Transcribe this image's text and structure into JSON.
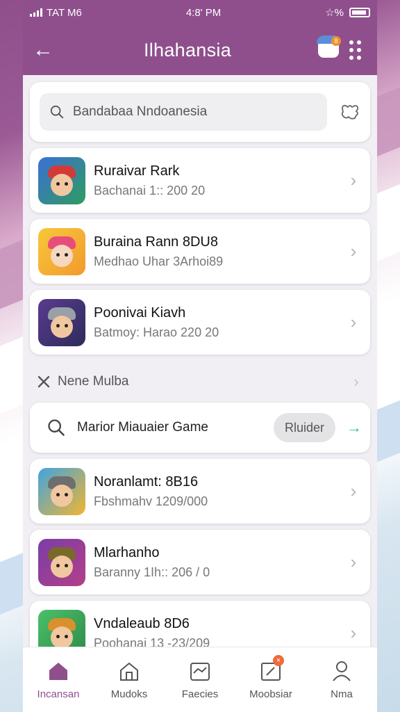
{
  "status": {
    "carrier": "TAT M6",
    "time": "4:8' PM",
    "extra": "☆%"
  },
  "header": {
    "title": "Ilhahansia"
  },
  "notification": {
    "badge": "8"
  },
  "search": {
    "placeholder": "Bandabaa Nndoanesia"
  },
  "games_top": [
    {
      "name": "Ruraivar Rark",
      "sub": "Bachanai 1:: 200 20"
    },
    {
      "name": "Buraina Rann 8DU8",
      "sub": "Medhao Uhar 3Arhoi89"
    },
    {
      "name": "Poonivai Kiavh",
      "sub": "Batmoy: Harao 220 20"
    }
  ],
  "section": {
    "label": "Nene Mulba"
  },
  "finder": {
    "text": "Marior Miauaier Game",
    "button": "Rluider"
  },
  "games_bottom": [
    {
      "name": "Noranlamt: 8B16",
      "sub": "Fbshmahv 1209/000"
    },
    {
      "name": "Mlarhanho",
      "sub": "Baranny 1Ih:: 206 / 0"
    },
    {
      "name": "Vndaleaub 8D6",
      "sub": "Poohanai 13 -23/209"
    }
  ],
  "nav": [
    {
      "label": "Incansan",
      "icon": "home-icon"
    },
    {
      "label": "Mudoks",
      "icon": "house-outline-icon"
    },
    {
      "label": "Faecies",
      "icon": "chart-icon"
    },
    {
      "label": "Moobsiar",
      "icon": "share-icon",
      "badge": "×"
    },
    {
      "label": "Nma",
      "icon": "profile-icon"
    }
  ],
  "colors": {
    "primary": "#8f4f8d",
    "accent_go": "#36c28a",
    "badge": "#ef6a3a"
  }
}
